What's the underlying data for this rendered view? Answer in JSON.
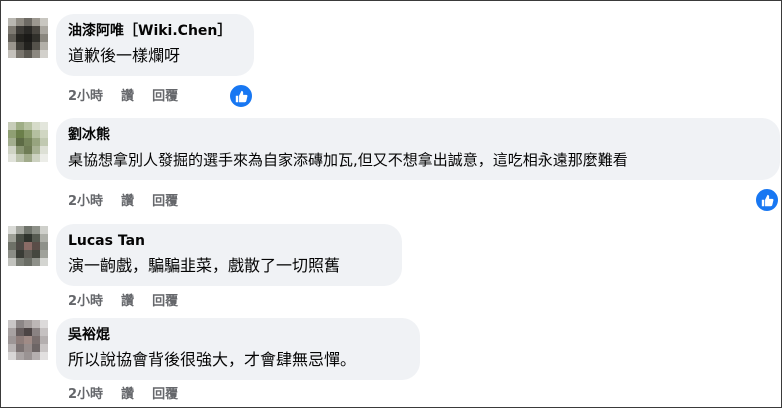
{
  "comments": [
    {
      "author": "油漆阿唯［Wiki.Chen］",
      "text": "道歉後一樣爛呀",
      "time": "2小時",
      "like_label": "讚",
      "reply_label": "回覆",
      "reaction_icon": "thumbs-up-icon"
    },
    {
      "author": "劉冰熊",
      "text": "桌協想拿別人發掘的選手來為自家添磚加瓦,但又不想拿出誠意，這吃相永遠那麼難看",
      "time": "2小時",
      "like_label": "讚",
      "reply_label": "回覆",
      "reaction_icon": "thumbs-up-icon"
    },
    {
      "author": "Lucas Tan",
      "text": "演一齣戲，騙騙韭菜，戲散了一切照舊",
      "time": "2小時",
      "like_label": "讚",
      "reply_label": "回覆"
    },
    {
      "author": "吳裕焜",
      "text": "所以說協會背後很強大，才會肆無忌憚。",
      "time": "2小時",
      "like_label": "讚",
      "reply_label": "回覆"
    }
  ],
  "colors": {
    "bubble": "#f0f2f5",
    "meta": "#65676b",
    "like_badge": "#1877f2"
  }
}
